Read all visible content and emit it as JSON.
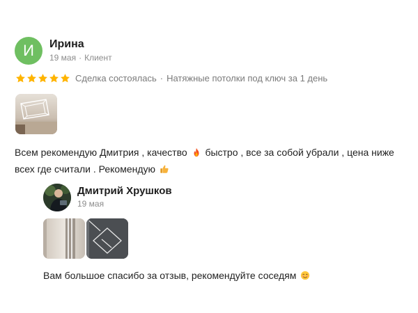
{
  "review": {
    "avatar_letter": "И",
    "avatar_color": "#6fbf61",
    "author": "Ирина",
    "date": "19 мая",
    "separator": "·",
    "role": "Клиент",
    "rating": 5,
    "rating_max": 5,
    "star_color": "#ffb400",
    "deal_status": "Сделка состоялась",
    "service": "Натяжные потолки под ключ за 1 день",
    "text_part1": "Всем рекомендую Дмитрия , качество",
    "emoji_1": "fire-emoji",
    "text_part2": "быстро , все за собой убрали , цена ниже всех где считали . Рекомендую",
    "emoji_2": "thumbs-up-emoji"
  },
  "reply": {
    "author": "Дмитрий Хрушков",
    "date": "19 мая",
    "text": "Вам большое спасибо за отзыв, рекомендуйте соседям",
    "emoji": "smiling-face-emoji"
  }
}
